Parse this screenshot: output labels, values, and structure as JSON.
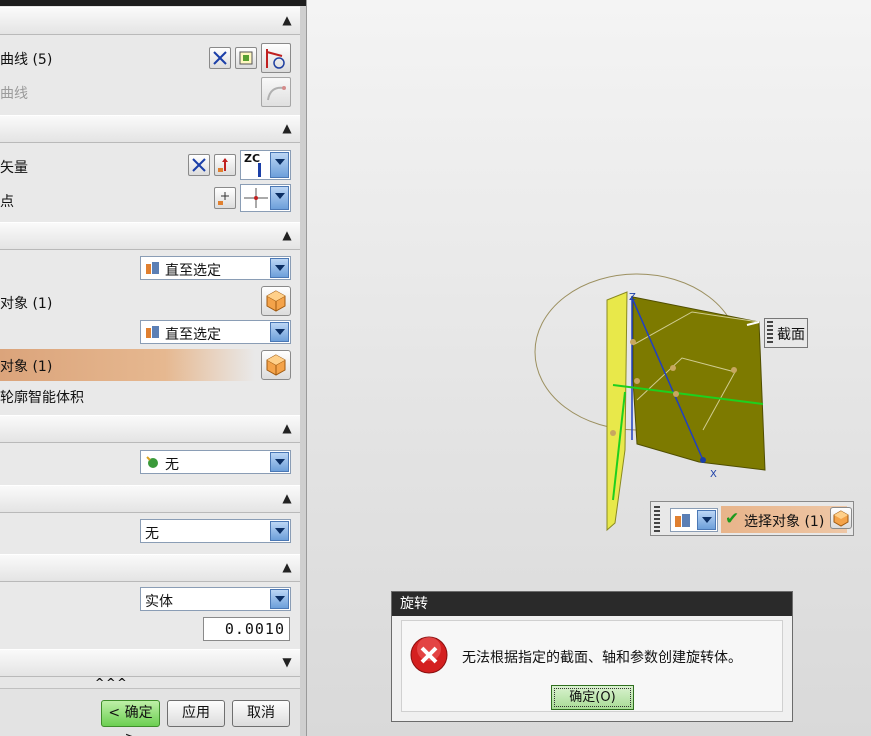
{
  "panel": {
    "section1": {
      "row1_label": "曲线 (5)",
      "row2_label": "曲线"
    },
    "section2": {
      "row1_label": "矢量",
      "row2_label": "点",
      "vector_dropdown_label": "ZC"
    },
    "section3": {
      "start_dropdown": "直至选定",
      "start_object_label": "对象 (1)",
      "end_dropdown": "直至选定",
      "end_object_label": "对象 (1)",
      "footer_label": "轮廓智能体积"
    },
    "section4": {
      "dropdown": "无"
    },
    "section5": {
      "dropdown": "无"
    },
    "section6": {
      "dropdown": "实体",
      "tolerance": "0.0010"
    },
    "more_chevrons": "^^^",
    "buttons": {
      "ok": "< 确定 >",
      "apply": "应用",
      "cancel": "取消"
    }
  },
  "viewport": {
    "section_tag": "截面",
    "axis_z": "Z",
    "axis_x": "X",
    "select_toolbar_label": "选择对象 (1)"
  },
  "error_dialog": {
    "title": "旋转",
    "message": "无法根据指定的截面、轴和参数创建旋转体。",
    "ok_label": "确定(O)"
  },
  "colors": {
    "sheet_fill": "#7d7a00",
    "sheet_yellow": "#e6e64a",
    "highlight_row": "#dba47b",
    "ok_button": "#6ccf52",
    "error_icon": "#d42020"
  }
}
